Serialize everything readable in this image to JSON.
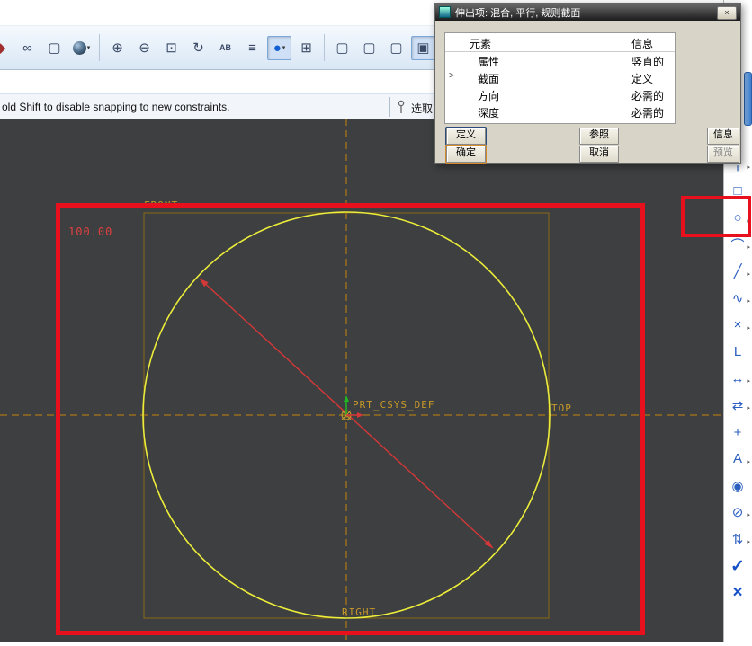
{
  "message_bar": {
    "text": "old Shift to disable snapping to new constraints.",
    "select_label": "选取"
  },
  "dialog": {
    "title": "伸出项: 混合, 平行, 规则截面",
    "close_glyph": "×",
    "table": {
      "headers": [
        "元素",
        "信息"
      ],
      "rows": [
        {
          "marker": "",
          "element": "属性",
          "info": "竖直的"
        },
        {
          "marker": ">",
          "element": "截面",
          "info": "定义"
        },
        {
          "marker": "",
          "element": "方向",
          "info": "必需的"
        },
        {
          "marker": "",
          "element": "深度",
          "info": "必需的"
        }
      ]
    },
    "buttons": {
      "define": "定义",
      "refs": "参照",
      "info": "信息",
      "ok": "确定",
      "cancel": "取消",
      "preview": "预览"
    }
  },
  "canvas": {
    "labels": {
      "front": "FRONT",
      "top": "TOP",
      "right": "RIGHT",
      "csys": "PRT_CSYS_DEF"
    },
    "dimension": "100.00"
  },
  "top_toolbar": {
    "icons": [
      {
        "name": "edge-partial-icon",
        "glyph": "◆",
        "color": "#a03030"
      },
      {
        "name": "view-glasses-icon",
        "glyph": "∞"
      },
      {
        "name": "wireframe-box-icon",
        "glyph": "▢"
      },
      {
        "name": "shaded-sphere-icon",
        "ball": true,
        "dropdown": true
      },
      {
        "sep": true
      },
      {
        "name": "zoom-in-icon",
        "glyph": "⊕"
      },
      {
        "name": "zoom-out-icon",
        "glyph": "⊖"
      },
      {
        "name": "zoom-fit-icon",
        "glyph": "⊡"
      },
      {
        "name": "reorient-view-icon",
        "glyph": "↻"
      },
      {
        "name": "annotation-ab-icon",
        "glyph": "AB",
        "small": true
      },
      {
        "name": "layers-icon",
        "glyph": "≡"
      },
      {
        "name": "spin-center-icon",
        "glyph": "●",
        "color": "#1560d0",
        "pressed": true,
        "dropdown": true
      },
      {
        "name": "saved-views-icon",
        "glyph": "⊞"
      },
      {
        "sep": true
      },
      {
        "name": "datum-plane-display-icon",
        "glyph": "▢"
      },
      {
        "name": "datum-axis-display-icon",
        "glyph": "▢"
      },
      {
        "name": "datum-point-display-icon",
        "glyph": "▢"
      },
      {
        "name": "shaded-display-icon",
        "glyph": "▣",
        "pressed": true
      },
      {
        "name": "angle-measure-icon",
        "glyph": "∠"
      }
    ]
  },
  "right_toolbar": {
    "icons": [
      {
        "name": "centerline-tool-icon",
        "glyph": "╎",
        "fly": true
      },
      {
        "name": "rectangle-tool-icon",
        "glyph": "□"
      },
      {
        "name": "circle-tool-icon",
        "glyph": "○",
        "fly": true
      },
      {
        "name": "arc-tool-icon",
        "glyph": "⌒",
        "fly": true
      },
      {
        "name": "fillet-tool-icon",
        "glyph": "╱",
        "fly": true
      },
      {
        "name": "spline-tool-icon",
        "glyph": "∿",
        "fly": true
      },
      {
        "name": "point-tool-icon",
        "glyph": "×",
        "fly": true
      },
      {
        "name": "csys-tool-icon",
        "glyph": "L"
      },
      {
        "name": "dimension-tool-icon",
        "glyph": "↔",
        "fly": true
      },
      {
        "name": "modify-tool-icon",
        "glyph": "⇄",
        "fly": true
      },
      {
        "name": "constraint-tool-icon",
        "glyph": "+"
      },
      {
        "name": "text-tool-icon",
        "glyph": "A",
        "fly": true
      },
      {
        "name": "palette-tool-icon",
        "glyph": "◉"
      },
      {
        "name": "trim-tool-icon",
        "glyph": "⊘",
        "fly": true
      },
      {
        "name": "mirror-tool-icon",
        "glyph": "⇅",
        "fly": true
      },
      {
        "name": "done-icon",
        "glyph": "✓",
        "big": true
      },
      {
        "name": "quit-icon",
        "glyph": "×",
        "big": true
      }
    ]
  },
  "colors": {
    "annotation_red": "#e8101c",
    "sketch_yellow": "#ecec3a",
    "centerline_orange": "#c8860a",
    "canvas_bg": "#3d3f41",
    "icon_blue": "#2b5fc0"
  }
}
